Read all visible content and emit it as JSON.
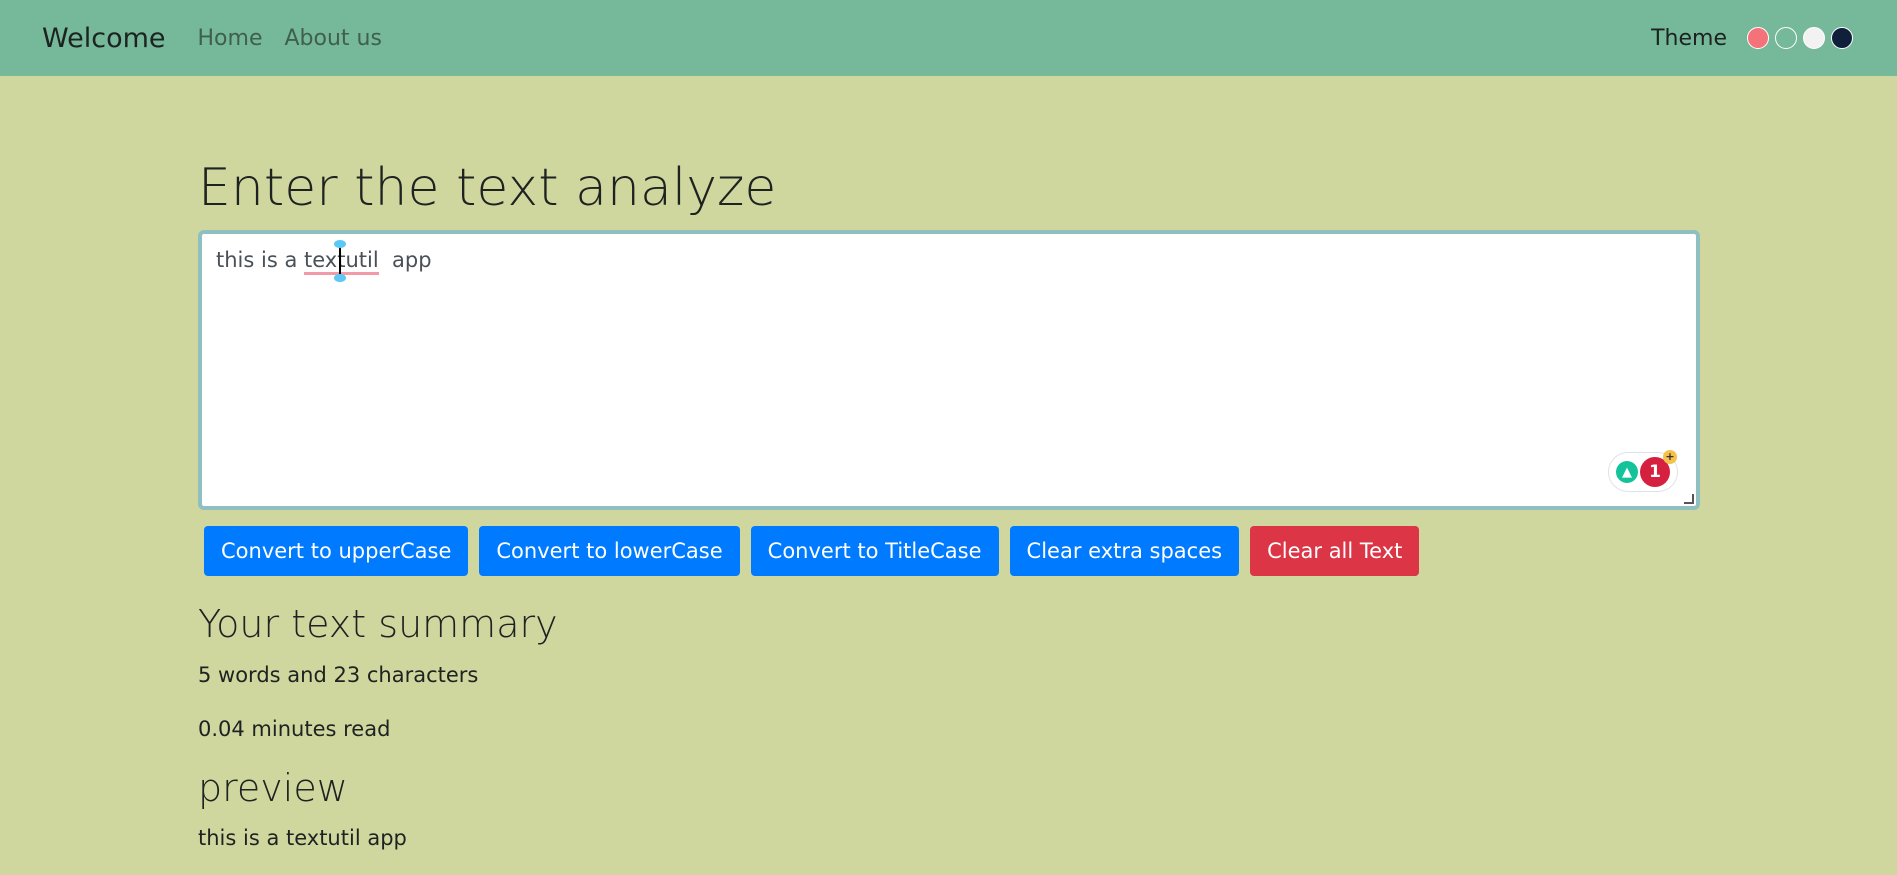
{
  "navbar": {
    "brand": "Welcome",
    "links": [
      "Home",
      "About us"
    ],
    "theme_label": "Theme",
    "theme_colors": [
      "#f4737a",
      "#76b89a",
      "#f2f2f2",
      "#10203a"
    ]
  },
  "main": {
    "title": "Enter the text analyze",
    "textarea": {
      "before": "this is a ",
      "misspelled": "textutil",
      "after": "  app"
    },
    "grammarly_count": "1",
    "buttons": [
      "Convert to upperCase",
      "Convert to lowerCase",
      "Convert to TitleCase",
      "Clear extra spaces",
      "Clear all Text"
    ],
    "summary_title": "Your text summary",
    "word_char_count": "5 words and 23 characters",
    "read_time": "0.04 minutes read",
    "preview_title": "preview",
    "preview_text": "this is a textutil app"
  },
  "colors": {
    "background": "#cfd79f",
    "navbar": "#76b89a",
    "primary_button": "#007bff",
    "danger_button": "#dc3545"
  }
}
